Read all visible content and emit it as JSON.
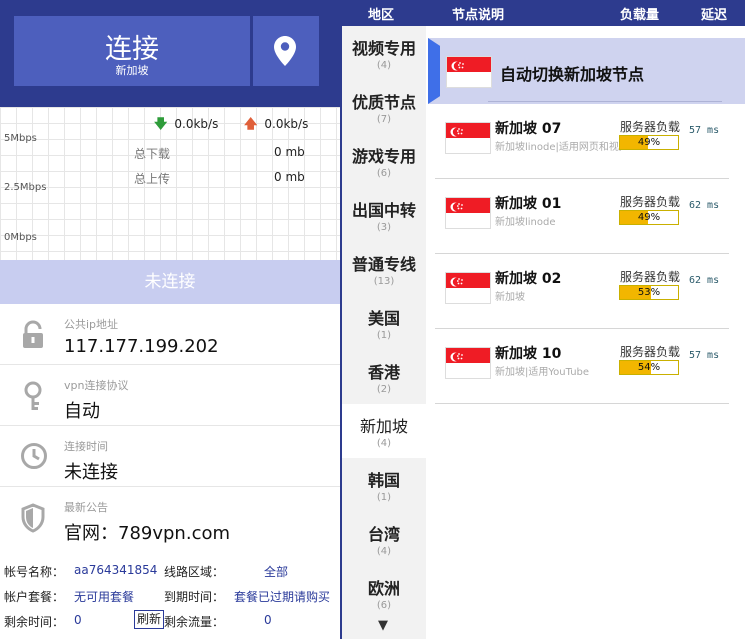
{
  "connect": {
    "title": "连接",
    "subtitle": "新加坡"
  },
  "graph": {
    "axis": [
      "5Mbps",
      "2.5Mbps",
      "0Mbps"
    ],
    "download_speed": "0.0kb/s",
    "upload_speed": "0.0kb/s",
    "total_download_label": "总下载",
    "total_download": "0 mb",
    "total_upload_label": "总上传",
    "total_upload": "0 mb"
  },
  "status": "未连接",
  "info": [
    {
      "label": "公共ip地址",
      "value": "117.177.199.202",
      "icon": "lock-icon"
    },
    {
      "label": "vpn连接协议",
      "value": "自动",
      "icon": "key-icon"
    },
    {
      "label": "连接时间",
      "value": "未连接",
      "icon": "clock-icon"
    },
    {
      "label": "最新公告",
      "value": "官网：789vpn.com",
      "icon": "shield-icon"
    }
  ],
  "account": {
    "name_label": "帐号名称：",
    "name": "aa764341854",
    "area_label": "线路区域：",
    "area": "全部",
    "plan_label": "帐户套餐：",
    "plan": "无可用套餐",
    "expire_label": "到期时间：",
    "expire": "套餐已过期请购买",
    "time_label": "剩余时间：",
    "time": "0",
    "refresh": "刷新",
    "traffic_label": "剩余流量：",
    "traffic": "0"
  },
  "header": {
    "region": "地区",
    "desc": "节点说明",
    "load": "负载量",
    "latency": "延迟"
  },
  "regions": [
    {
      "name": "视频专用",
      "count": "(4)"
    },
    {
      "name": "优质节点",
      "count": "(7)"
    },
    {
      "name": "游戏专用",
      "count": "(6)"
    },
    {
      "name": "出国中转",
      "count": "(3)"
    },
    {
      "name": "普通专线",
      "count": "(13)"
    },
    {
      "name": "美国",
      "count": "(1)"
    },
    {
      "name": "香港",
      "count": "(2)"
    },
    {
      "name": "新加坡",
      "count": "(4)"
    },
    {
      "name": "韩国",
      "count": "(1)"
    },
    {
      "name": "台湾",
      "count": "(4)"
    },
    {
      "name": "欧洲",
      "count": "(6)"
    }
  ],
  "active_region": 7,
  "scroll_down": "▼",
  "auto_node": "自动切换新加坡节点",
  "nodes": [
    {
      "name": "新加坡 07",
      "desc": "新加坡linode|适用网页和视频",
      "load_label": "服务器负载",
      "load": "49%",
      "load_value": 49,
      "latency": "57 ms"
    },
    {
      "name": "新加坡 01",
      "desc": "新加坡linode",
      "load_label": "服务器负载",
      "load": "49%",
      "load_value": 49,
      "latency": "62 ms"
    },
    {
      "name": "新加坡 02",
      "desc": "新加坡",
      "load_label": "服务器负载",
      "load": "53%",
      "load_value": 53,
      "latency": "62 ms"
    },
    {
      "name": "新加坡 10",
      "desc": "新加坡|适用YouTube",
      "load_label": "服务器负载",
      "load": "54%",
      "load_value": 54,
      "latency": "57 ms"
    }
  ]
}
